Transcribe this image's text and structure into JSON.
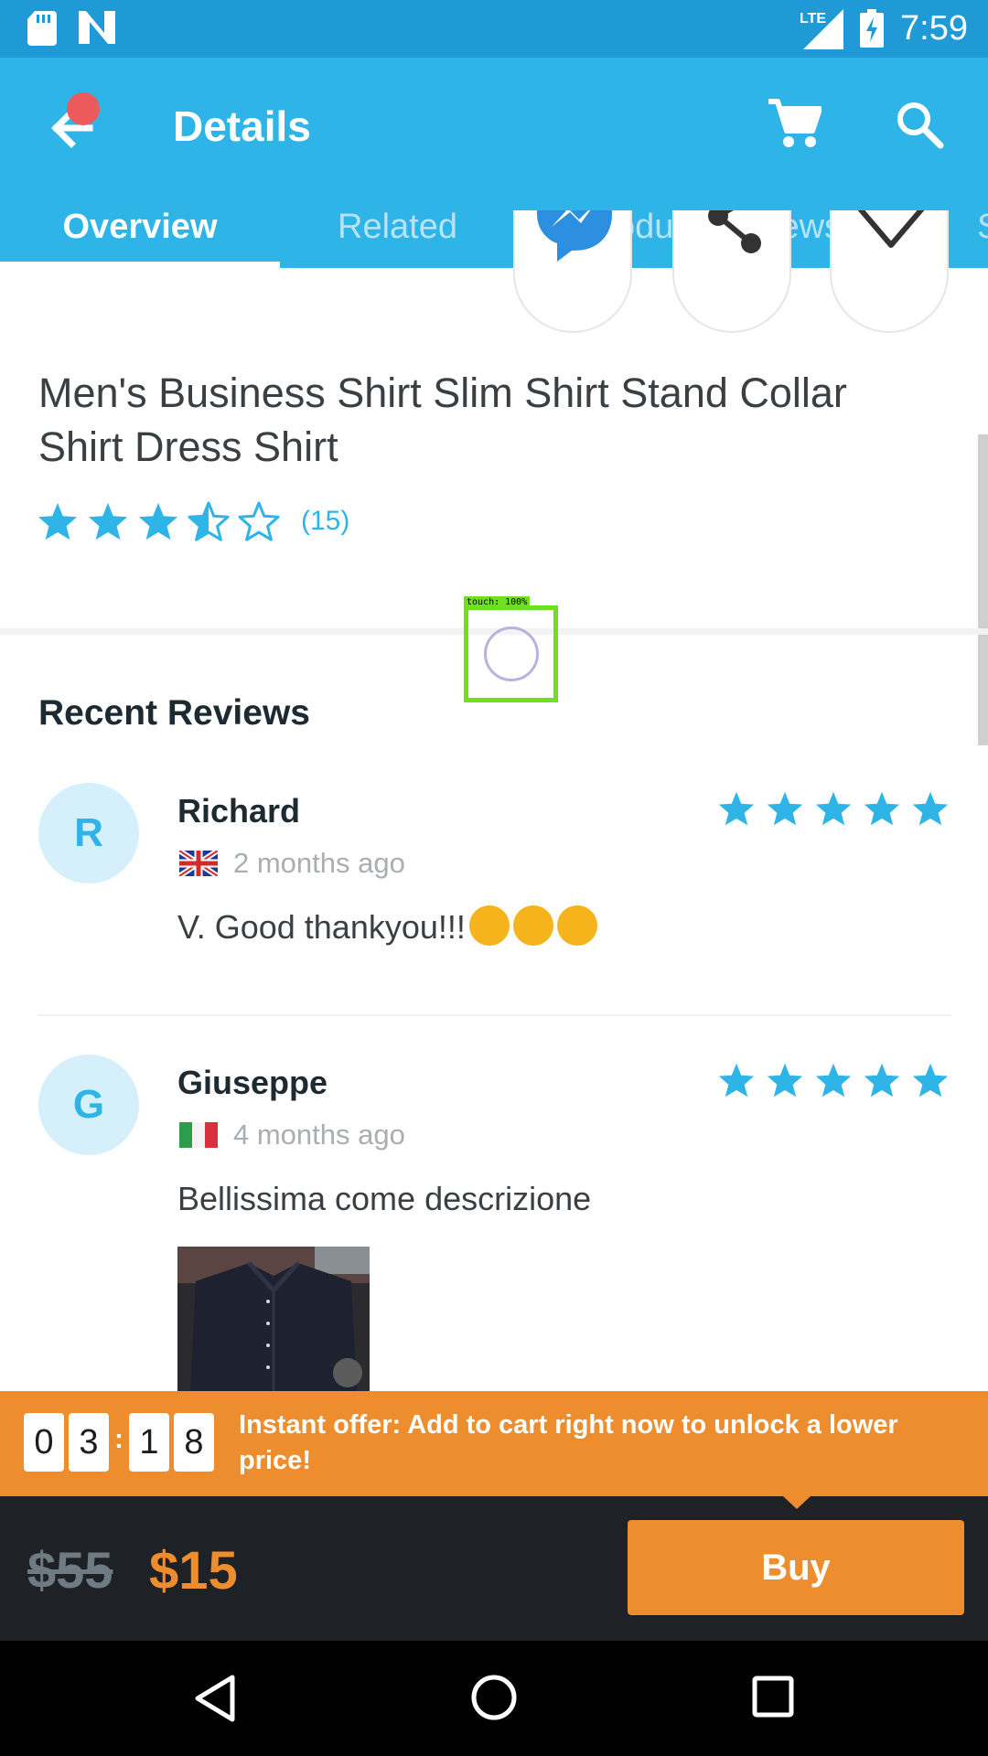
{
  "status_bar": {
    "time": "7:59",
    "network": "LTE"
  },
  "app_bar": {
    "title": "Details",
    "tabs": [
      {
        "label": "Overview",
        "active": true
      },
      {
        "label": "Related"
      },
      {
        "label": "Product Reviews"
      },
      {
        "label": "S"
      }
    ]
  },
  "product": {
    "title": "Men's Business Shirt Slim Shirt Stand Collar Shirt Dress Shirt",
    "rating": 3.5,
    "rating_count": "(15)"
  },
  "touch_overlay": {
    "label": "touch: 100%"
  },
  "reviews": {
    "title": "Recent Reviews",
    "items": [
      {
        "initial": "R",
        "name": "Richard",
        "flag": "uk-flag",
        "date": "2 months ago",
        "text": "V. Good thankyou!!!",
        "stars": 5,
        "emoji_count": 3
      },
      {
        "initial": "G",
        "name": "Giuseppe",
        "flag": "italy-flag",
        "date": "4 months ago",
        "text": "Bellissima come descrizione",
        "stars": 5,
        "has_photo": true
      }
    ]
  },
  "offer": {
    "timer_digits": [
      "0",
      "3",
      "1",
      "8"
    ],
    "separator": ":",
    "text": "Instant offer: Add to cart right now to unlock a lower price!"
  },
  "purchase": {
    "old_price": "$55",
    "new_price": "$15",
    "buy_label": "Buy"
  },
  "colors": {
    "primary_blue": "#2fb4e8",
    "status_blue": "#1f9ad6",
    "accent_orange": "#ed8d2d",
    "dark_bar": "#1e2226",
    "notification_red": "#ec5a5c"
  }
}
